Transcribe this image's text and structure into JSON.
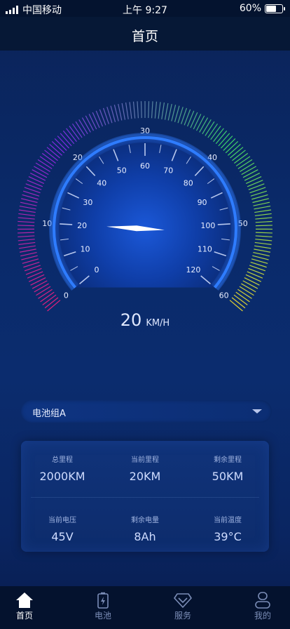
{
  "status_bar": {
    "carrier": "中国移动",
    "time": "上午 9:27",
    "battery": "60%",
    "battery_level": 0.6
  },
  "header": {
    "title": "首页"
  },
  "gauge": {
    "speed": "20",
    "unit": "KM/H",
    "speed_value": 20,
    "outer_ticks": [
      "0",
      "10",
      "20",
      "30",
      "40",
      "50",
      "60"
    ],
    "inner_ticks": [
      "0",
      "10",
      "20",
      "30",
      "40",
      "50",
      "60",
      "70",
      "80",
      "90",
      "100",
      "110",
      "120"
    ],
    "colors": {
      "start": "#e0207a",
      "mid": "#7a2ce0",
      "green": "#3bd16a",
      "end": "#e0d030"
    }
  },
  "battery_selector": {
    "label": "电池组A"
  },
  "stats": {
    "total_mileage_label": "总里程",
    "total_mileage_value": "2000KM",
    "current_mileage_label": "当前里程",
    "current_mileage_value": "20KM",
    "remaining_mileage_label": "剩余里程",
    "remaining_mileage_value": "50KM",
    "current_voltage_label": "当前电压",
    "current_voltage_value": "45V",
    "remaining_charge_label": "剩余电量",
    "remaining_charge_value": "8Ah",
    "current_temp_label": "当前温度",
    "current_temp_value": "39°C"
  },
  "tabs": [
    {
      "label": "首页",
      "icon": "home-icon",
      "active": true
    },
    {
      "label": "电池",
      "icon": "battery-icon",
      "active": false
    },
    {
      "label": "服务",
      "icon": "diamond-icon",
      "active": false
    },
    {
      "label": "我的",
      "icon": "user-icon",
      "active": false
    }
  ]
}
